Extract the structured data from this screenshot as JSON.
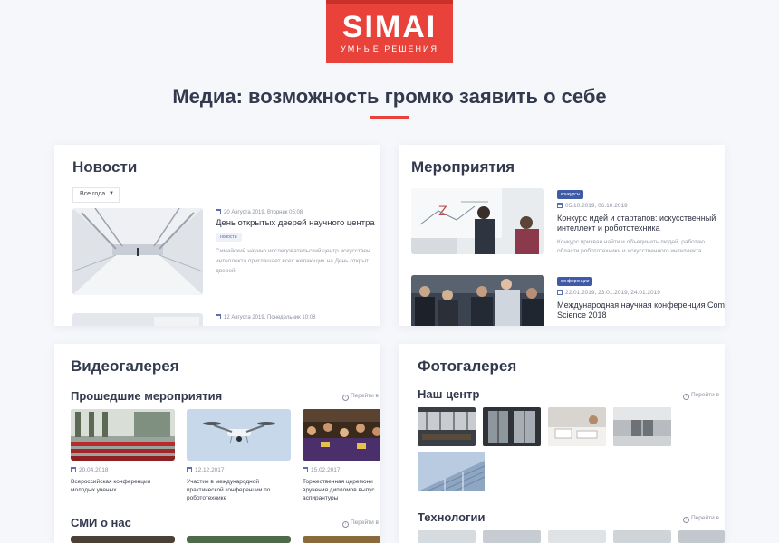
{
  "logo": {
    "brand": "SIMAI",
    "tagline": "УМНЫЕ РЕШЕНИЯ"
  },
  "headline": "Медиа: возможность громко заявить о себе",
  "colors": {
    "accent": "#e8423b",
    "badge_blue": "#3f5aa6"
  },
  "news": {
    "title": "Новости",
    "year_select": "Все года",
    "items": [
      {
        "meta": "20 Августа 2019, Вторник 05:08",
        "title": "День открытых дверей научного центра",
        "badge": "новости",
        "text_lines": [
          "Симайский научно исследовательский центр искусствен",
          "интеллекта приглашает всех желающих на День открыт",
          "дверей!"
        ]
      },
      {
        "meta": "12 Августа 2019, Понедельник 10:08"
      }
    ]
  },
  "events": {
    "title": "Мероприятия",
    "items": [
      {
        "badge": "конкурсы",
        "date": "05.10.2019, 06.10.2019",
        "title_lines": [
          "Конкурс идей и стартапов: искусственный",
          "интеллект и робототехника"
        ],
        "text_lines": [
          "Конкурс призван найти и объединить людей, работаю",
          "области робототехники и искусственного интеллекта."
        ]
      },
      {
        "badge": "конференции",
        "date": "22.01.2019, 23.01.2019, 24.01.2019",
        "title_lines": [
          "Международная научная конференция Com",
          "Science 2018"
        ]
      }
    ]
  },
  "video": {
    "title": "Видеогалерея",
    "past_label": "Прошедшие мероприятия",
    "go_label": "Перейти в",
    "items": [
      {
        "date": "20.04.2018",
        "title_lines": [
          "Всероссийская конференция",
          "молодых ученых"
        ]
      },
      {
        "date": "12.12.2017",
        "title_lines": [
          "Участие в международной",
          "практической конференции по",
          "робототехнике"
        ]
      },
      {
        "date": "15.02.2017",
        "title_lines": [
          "Торжественная церемони",
          "вручения дипломов выпус",
          "аспирантуры"
        ]
      }
    ],
    "media_label": "СМИ о нас",
    "media_go_label": "Перейти в"
  },
  "photo": {
    "title": "Фотогалерея",
    "center_label": "Наш центр",
    "go_label": "Перейти в",
    "tech_label": "Технологии",
    "tech_go_label": "Перейти в"
  }
}
